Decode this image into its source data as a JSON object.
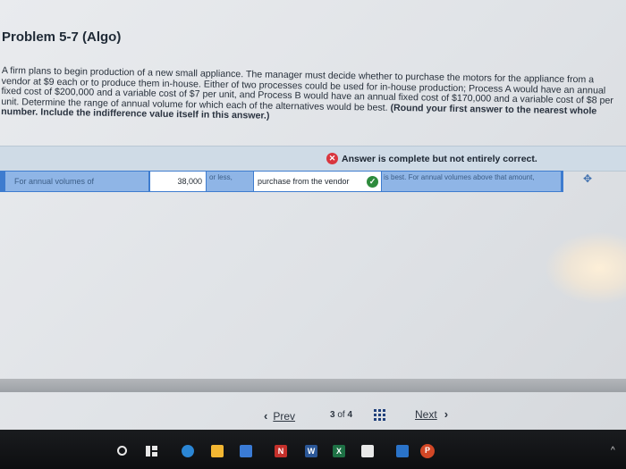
{
  "problem": {
    "title": "Problem 5-7 (Algo)",
    "text": "A firm plans to begin production of a new small appliance. The manager must decide whether to purchase the motors for the appliance from a vendor at $9 each or to produce them in-house. Either of two processes could be used for in-house production; Process A would have an annual fixed cost of $200,000 and a variable cost of $7 per unit, and Process B would have an annual fixed cost of $170,000 and a variable cost of $8 per unit. Determine the range of annual volume for which each of the alternatives would be best.",
    "instruction": "(Round your first answer to the nearest whole number. Include the indifference value itself in this answer.)"
  },
  "answer": {
    "status": "Answer is complete but not entirely correct.",
    "row": {
      "label": "For annual volumes of",
      "value": "38,000",
      "or_less": "or less,",
      "choice": "purchase from the vendor",
      "suffix": "is best. For annual volumes above that amount,"
    }
  },
  "pager": {
    "prev": "Prev",
    "current": "3",
    "of": "of",
    "total": "4",
    "next": "Next"
  },
  "colors": {
    "answer_bar": "#cfdbe6",
    "row_blue": "#3e7ccf",
    "label_cell": "#8fb5e6",
    "incorrect": "#d9363e",
    "correct": "#2e8b3d"
  },
  "icons": {
    "status": "x-circle-icon",
    "value_mark": "x-circle-icon",
    "choice_mark": "check-circle-icon",
    "expand": "plus-icon",
    "prev": "chevron-left-icon",
    "next": "chevron-right-icon",
    "overview": "grid-icon"
  }
}
